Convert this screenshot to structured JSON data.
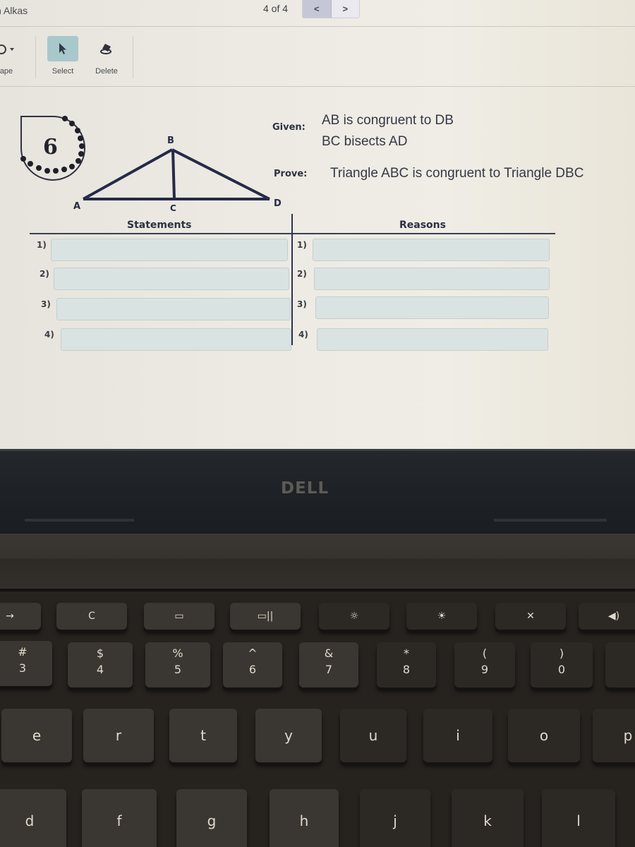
{
  "app": {
    "user_name_partial": "n Alkas",
    "page_counter": "4 of 4",
    "pager": {
      "prev_icon": "chevron-left",
      "next_icon": "chevron-right",
      "prev_label": "<",
      "next_label": ">"
    }
  },
  "toolbar": {
    "tools": [
      {
        "label": "ape",
        "icon": "shape-icon",
        "active": false
      },
      {
        "label": "Select",
        "icon": "cursor-arrow-icon",
        "active": true
      },
      {
        "label": "Delete",
        "icon": "eraser-icon",
        "active": false
      }
    ]
  },
  "problem": {
    "number": "6",
    "given_label": "Given:",
    "given": [
      "AB is congruent to DB",
      "BC bisects AD"
    ],
    "prove_label": "Prove:",
    "prove": "Triangle ABC is congruent to Triangle DBC",
    "diagram": {
      "vertices": {
        "A": "A",
        "B": "B",
        "C": "C",
        "D": "D"
      },
      "segments": [
        "AB",
        "BD",
        "AD",
        "BC"
      ]
    }
  },
  "proof_table": {
    "statements_header": "Statements",
    "reasons_header": "Reasons",
    "rows": [
      {
        "num": "1)",
        "statement": "",
        "reason": ""
      },
      {
        "num": "2)",
        "statement": "",
        "reason": ""
      },
      {
        "num": "3)",
        "statement": "",
        "reason": ""
      },
      {
        "num": "4)",
        "statement": "",
        "reason": ""
      }
    ]
  },
  "laptop": {
    "brand": "DELL",
    "fn_row": [
      "→",
      "C",
      "▭",
      "▭||",
      "☼",
      "☀",
      "✕",
      "◀)"
    ],
    "number_row": [
      {
        "top": "#",
        "bottom": "3"
      },
      {
        "top": "$",
        "bottom": "4"
      },
      {
        "top": "%",
        "bottom": "5"
      },
      {
        "top": "^",
        "bottom": "6"
      },
      {
        "top": "&",
        "bottom": "7"
      },
      {
        "top": "*",
        "bottom": "8"
      },
      {
        "top": "(",
        "bottom": "9"
      },
      {
        "top": ")",
        "bottom": "0"
      }
    ],
    "top_letters": [
      "e",
      "r",
      "t",
      "y",
      "u",
      "i",
      "o",
      "p"
    ],
    "home_letters": [
      "d",
      "f",
      "g",
      "h",
      "j",
      "k",
      "l"
    ]
  }
}
